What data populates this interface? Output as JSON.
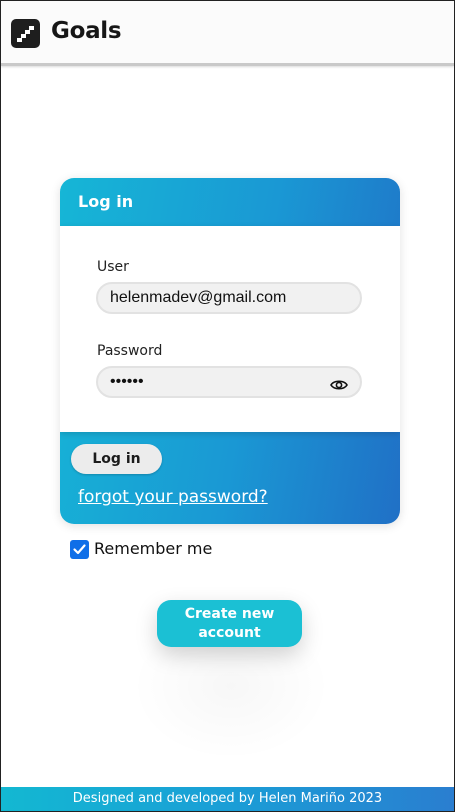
{
  "header": {
    "logo_icon": "stairs-icon",
    "title": "Goals"
  },
  "login_card": {
    "title": "Log in",
    "user_label": "User",
    "user_value": "helenmadev@gmail.com",
    "password_label": "Password",
    "password_value": "••••••",
    "password_toggle_icon": "eye-icon",
    "login_button_label": "Log in",
    "forgot_link": "forgot your password?"
  },
  "remember_me": {
    "label": "Remember me",
    "checked": true
  },
  "create_account_button": "Create new account",
  "footer": {
    "text": "Designed and developed by Helen Mariño 2023"
  },
  "colors": {
    "accent_start": "#16b6d6",
    "accent_end": "#2070c6",
    "create_button": "#1bc0d4",
    "checkbox": "#0f6fe8"
  }
}
